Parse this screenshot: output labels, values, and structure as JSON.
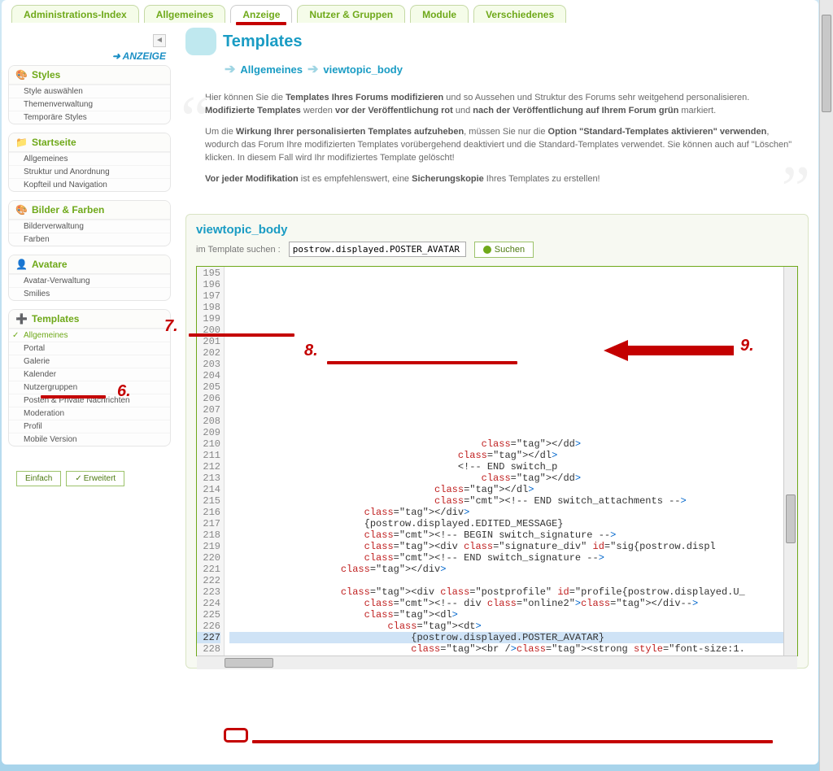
{
  "tabs": [
    {
      "label": "Administrations-Index",
      "active": false
    },
    {
      "label": "Allgemeines",
      "active": false
    },
    {
      "label": "Anzeige",
      "active": true
    },
    {
      "label": "Nutzer & Gruppen",
      "active": false
    },
    {
      "label": "Module",
      "active": false
    },
    {
      "label": "Verschiedenes",
      "active": false
    }
  ],
  "anzeige_link": "ANZEIGE",
  "sidebar_panels": [
    {
      "title": "Styles",
      "icon": "🎨",
      "items": [
        {
          "label": "Style auswählen"
        },
        {
          "label": "Themenverwaltung"
        },
        {
          "label": "Temporäre Styles"
        }
      ]
    },
    {
      "title": "Startseite",
      "icon": "📁",
      "items": [
        {
          "label": "Allgemeines"
        },
        {
          "label": "Struktur und Anordnung"
        },
        {
          "label": "Kopfteil und Navigation"
        }
      ]
    },
    {
      "title": "Bilder & Farben",
      "icon": "🎨",
      "items": [
        {
          "label": "Bilderverwaltung"
        },
        {
          "label": "Farben"
        }
      ]
    },
    {
      "title": "Avatare",
      "icon": "👤",
      "items": [
        {
          "label": "Avatar-Verwaltung"
        },
        {
          "label": "Smilies"
        }
      ]
    },
    {
      "title": "Templates",
      "icon": "➕",
      "items": [
        {
          "label": "Allgemeines",
          "active": true
        },
        {
          "label": "Portal"
        },
        {
          "label": "Galerie"
        },
        {
          "label": "Kalender"
        },
        {
          "label": "Nutzergruppen"
        },
        {
          "label": "Posten & Private Nachrichten"
        },
        {
          "label": "Moderation"
        },
        {
          "label": "Profil"
        },
        {
          "label": "Mobile Version"
        }
      ]
    }
  ],
  "mode_buttons": {
    "simple": "Einfach",
    "advanced": "Erweitert"
  },
  "page": {
    "title": "Templates",
    "breadcrumb": [
      "Allgemeines",
      "viewtopic_body"
    ],
    "intro_p1_a": "Hier können Sie die ",
    "intro_p1_b": "Templates Ihres Forums modifizieren",
    "intro_p1_c": " und so Aussehen und Struktur des Forums sehr weitgehend personalisieren. ",
    "intro_p1_d": "Modifizierte Templates",
    "intro_p1_e": " werden ",
    "intro_p1_f": "vor der Veröffentlichung rot",
    "intro_p1_g": " und ",
    "intro_p1_h": "nach der Veröffentlichung auf Ihrem Forum grün",
    "intro_p1_i": " markiert.",
    "intro_p2_a": "Um die ",
    "intro_p2_b": "Wirkung Ihrer personalisierten Templates aufzuheben",
    "intro_p2_c": ", müssen Sie nur die ",
    "intro_p2_d": "Option \"Standard-Templates aktivieren\" verwenden",
    "intro_p2_e": ", wodurch das Forum Ihre modifizierten Templates vorübergehend deaktiviert und die Standard-Templates verwendet. Sie können auch auf \"Löschen\" klicken. In diesem Fall wird Ihr modifiziertes Template gelöscht!",
    "intro_p3_a": "Vor jeder Modifikation",
    "intro_p3_b": " ist es empfehlenswert, eine ",
    "intro_p3_c": "Sicherungskopie",
    "intro_p3_d": " Ihres Templates zu erstellen!"
  },
  "editor": {
    "title": "viewtopic_body",
    "search_label": "im Template suchen :",
    "search_value": "postrow.displayed.POSTER_AVATAR",
    "search_button": "Suchen",
    "first_line": 195,
    "selected_line": 227,
    "lines": [
      "",
      "",
      "",
      "",
      "",
      "",
      "",
      "",
      "",
      "",
      "",
      "",
      "",
      "",
      "",
      "                                           </dd>",
      "                                       </dl>",
      "                                       <!-- END switch_p",
      "                                           </dd>",
      "                                   </dl>",
      "                                   <!-- END switch_attachments -->",
      "                       </div>",
      "                       {postrow.displayed.EDITED_MESSAGE}",
      "                       <!-- BEGIN switch_signature -->",
      "                       <div class=\"signature_div\" id=\"sig{postrow.displ",
      "                       <!-- END switch_signature -->",
      "                   </div>",
      "",
      "                   <div class=\"postprofile\" id=\"profile{postrow.displayed.U_",
      "                       <!-- div class=\"online2\"></div-->",
      "                       <dl>",
      "                           <dt>",
      "                               {postrow.displayed.POSTER_AVATAR}",
      "                               <br /><strong style=\"font-size:1."
    ]
  },
  "annotations": {
    "n6": "6.",
    "n7": "7.",
    "n8": "8.",
    "n9": "9."
  }
}
